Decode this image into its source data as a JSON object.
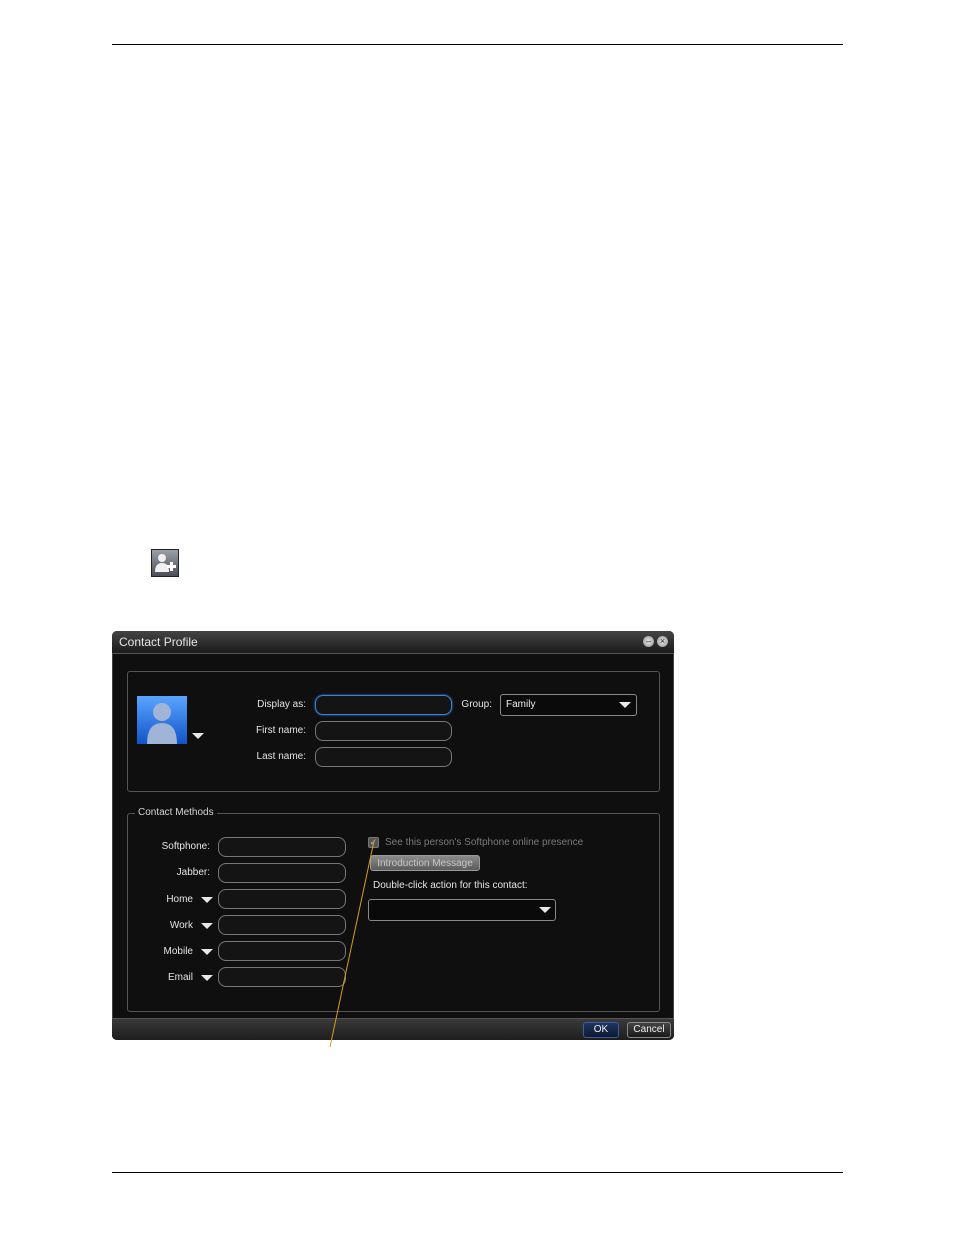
{
  "window": {
    "title": "Contact Profile"
  },
  "profile": {
    "display_as_label": "Display as:",
    "display_as_value": "",
    "first_name_label": "First name:",
    "first_name_value": "",
    "last_name_label": "Last name:",
    "last_name_value": "",
    "group_label": "Group:",
    "group_value": "Family"
  },
  "contact_methods": {
    "legend": "Contact Methods",
    "rows": [
      {
        "label": "Softphone:",
        "value": ""
      },
      {
        "label": "Jabber:",
        "value": ""
      },
      {
        "label": "Home",
        "value": ""
      },
      {
        "label": "Work",
        "value": ""
      },
      {
        "label": "Mobile",
        "value": ""
      },
      {
        "label": "Email",
        "value": ""
      }
    ],
    "presence_checkbox_label": "See this person's Softphone online presence",
    "presence_checked": true,
    "intro_button": "Introduction Message",
    "double_click_label": "Double-click action for this contact:",
    "double_click_value": ""
  },
  "footer": {
    "ok": "OK",
    "cancel": "Cancel"
  },
  "colors": {
    "dialog_bg": "#0f0f10",
    "accent": "#3a7fd8",
    "callout_line": "#d4a017"
  },
  "icons": [
    "add-contact-icon",
    "minimize-icon",
    "close-icon",
    "avatar-icon",
    "chevron-down-icon",
    "checkmark-icon"
  ]
}
